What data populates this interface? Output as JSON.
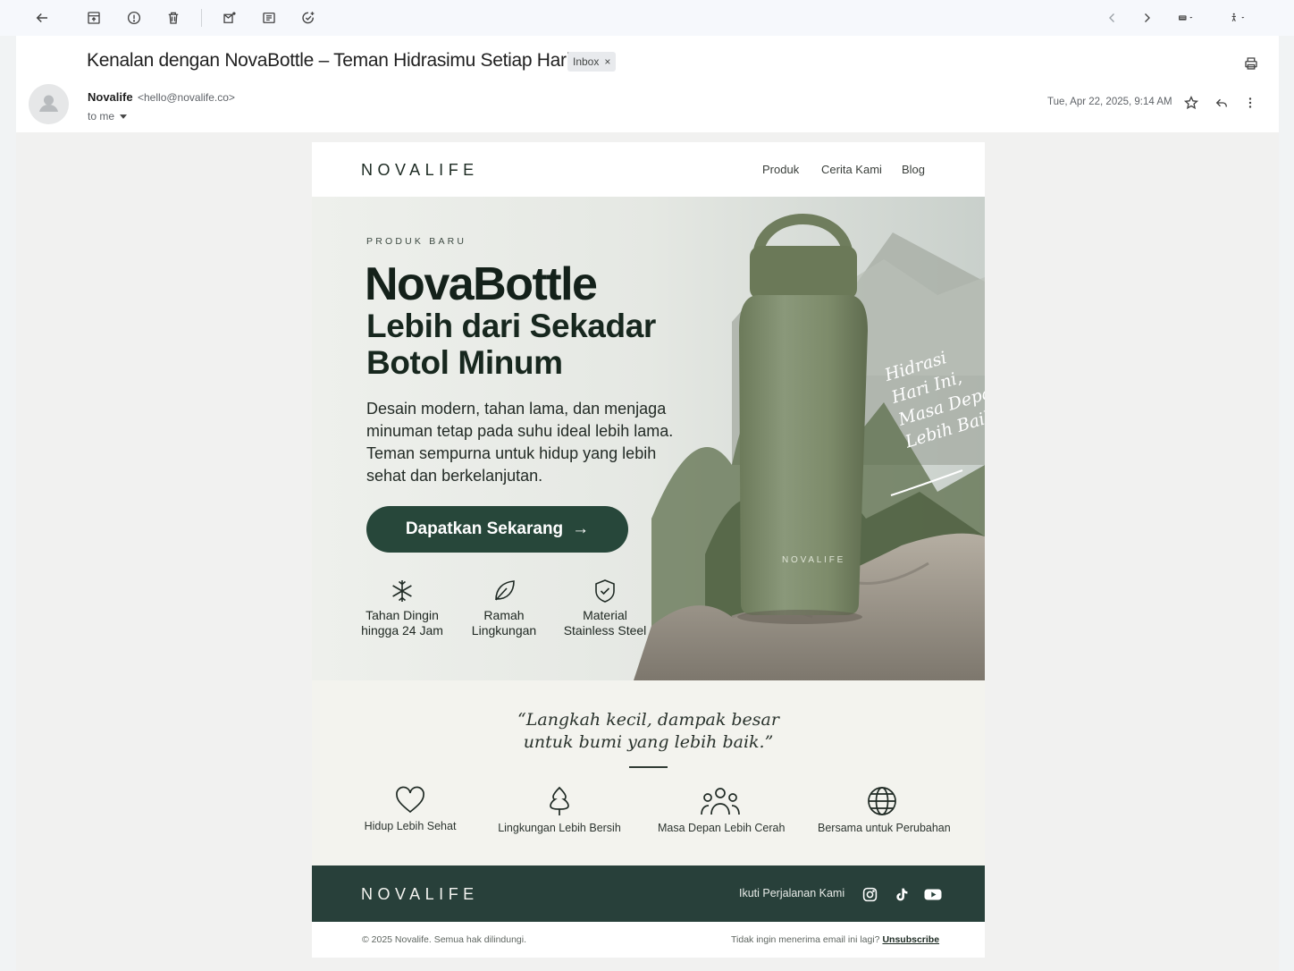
{
  "toolbar": {
    "back": "back-arrow-icon",
    "actions": [
      "archive-icon",
      "report-spam-icon",
      "delete-icon",
      "mark-unread-icon",
      "move-to-icon",
      "add-task-icon"
    ],
    "nav_prev": "chevron-left-icon",
    "nav_next": "chevron-right-icon",
    "input_tools": "keyboard-icon",
    "accessibility": "accessibility-icon"
  },
  "message": {
    "subject": "Kenalan dengan NovaBottle – Teman Hidrasimu Setiap Hari",
    "label": "Inbox",
    "label_close": "×",
    "sender_name": "Novalife",
    "sender_email": "<hello@novalife.co>",
    "recipient": "to me",
    "date": "Tue, Apr 22, 2025, 9:14 AM"
  },
  "email": {
    "brand": "NOVALIFE",
    "nav": [
      "Produk",
      "Cerita Kami",
      "Blog"
    ],
    "hero": {
      "eyebrow": "PRODUK BARU",
      "title": "NovaBottle",
      "subtitle": "Lebih dari Sekadar Botol Minum",
      "body": "Desain modern, tahan lama, dan menjaga minuman tetap pada suhu ideal lebih lama. Teman sempurna untuk hidup yang lebih sehat dan berkelanjutan.",
      "cta": "Dapatkan Sekarang",
      "cta_icon": "→",
      "bottle_brand": "NOVALIFE",
      "handwritten": [
        "Hidrasi",
        "Hari Ini,",
        "Masa Depan",
        "Lebih Baik"
      ],
      "features": [
        {
          "icon": "snowflake-icon",
          "line1": "Tahan Dingin",
          "line2": "hingga 24 Jam"
        },
        {
          "icon": "leaf-icon",
          "line1": "Ramah",
          "line2": "Lingkungan"
        },
        {
          "icon": "shield-check-icon",
          "line1": "Material",
          "line2": "Stainless Steel"
        }
      ]
    },
    "quote": {
      "line1": "“Langkah kecil, dampak besar",
      "line2": "untuk bumi yang lebih baik.”"
    },
    "values": [
      {
        "icon": "heart-icon",
        "label": "Hidup Lebih Sehat"
      },
      {
        "icon": "tree-icon",
        "label": "Lingkungan Lebih Bersih"
      },
      {
        "icon": "people-icon",
        "label": "Masa Depan Lebih Cerah"
      },
      {
        "icon": "globe-icon",
        "label": "Bersama untuk Perubahan"
      }
    ],
    "footer": {
      "brand": "NOVALIFE",
      "follow": "Ikuti Perjalanan Kami",
      "social": [
        "instagram-icon",
        "tiktok-icon",
        "youtube-icon"
      ]
    },
    "legal": {
      "copyright": "© 2025 Novalife. Semua hak dilindungi.",
      "unsubscribe_prompt": "Tidak ingin menerima email ini lagi?",
      "unsubscribe": "Unsubscribe"
    }
  },
  "colors": {
    "brand_dark": "#28403a",
    "cta": "#27473a",
    "bottle": "#7d8b6a"
  }
}
